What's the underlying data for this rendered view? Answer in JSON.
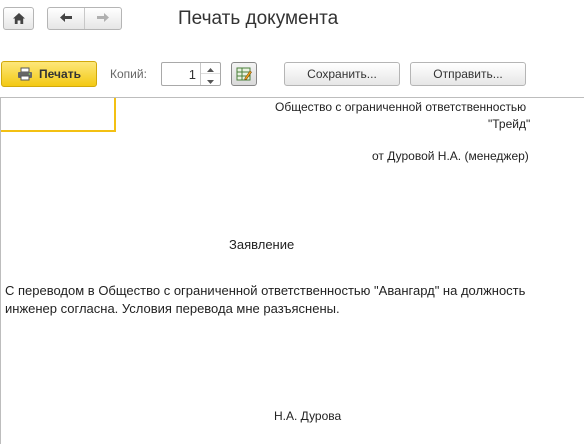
{
  "window": {
    "title": "Печать документа"
  },
  "toolbar": {
    "print_label": "Печать",
    "copies_label": "Копий:",
    "copies_value": "1",
    "save_label": "Сохранить...",
    "send_label": "Отправить..."
  },
  "document": {
    "org_line1": "Общество с ограниченной ответственностью",
    "org_line2": "\"Трейд\"",
    "from_line": "от Дуровой Н.А. (менеджер)",
    "statement_title": "Заявление",
    "body": "С переводом в Общество с ограниченной ответственностью \"Авангард\" на должность инженер согласна. Условия перевода мне разъяснены.",
    "signature": "Н.А. Дурова"
  },
  "colors": {
    "print_button": "#f3c914",
    "cell_cursor": "#f3c013"
  },
  "icons": {
    "home": "home-icon",
    "back": "arrow-left-icon",
    "forward": "arrow-right-icon",
    "print": "printer-icon",
    "edit": "edit-table-icon"
  }
}
